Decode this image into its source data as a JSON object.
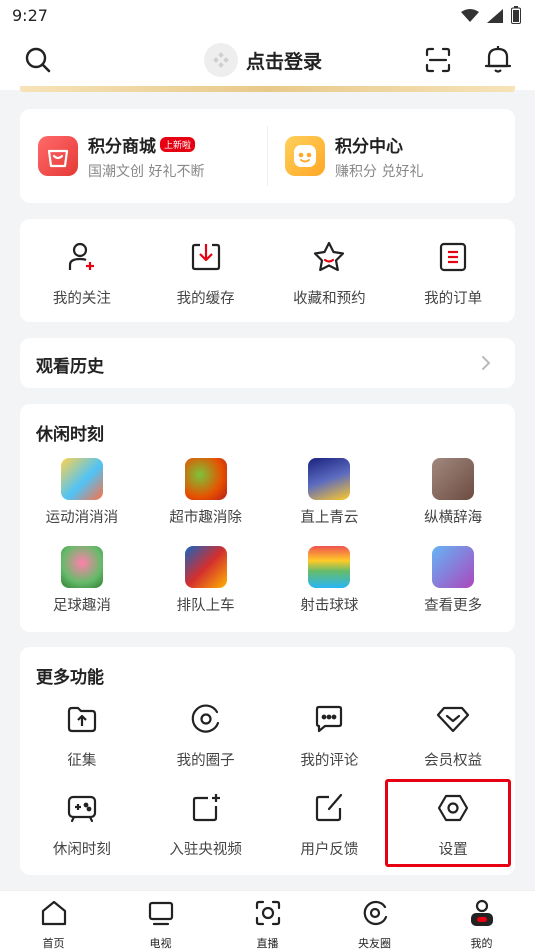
{
  "status_bar": {
    "time": "9:27",
    "icons": [
      "wifi-icon",
      "signal-icon",
      "battery-icon"
    ]
  },
  "header": {
    "login_label": "点击登录",
    "icons": [
      "search-icon",
      "scan-icon",
      "bell-icon"
    ]
  },
  "points": [
    {
      "title": "积分商城",
      "badge": "上新啦",
      "subtitle": "国潮文创 好礼不断",
      "icon": "shopping-bag-icon",
      "color": "#f24a4a"
    },
    {
      "title": "积分中心",
      "subtitle": "赚积分 兑好礼",
      "icon": "coin-face-icon",
      "color": "#ffb020"
    }
  ],
  "quick_actions": [
    {
      "label": "我的关注",
      "icon": "follow-user-icon"
    },
    {
      "label": "我的缓存",
      "icon": "download-icon"
    },
    {
      "label": "收藏和预约",
      "icon": "star-icon"
    },
    {
      "label": "我的订单",
      "icon": "order-icon"
    }
  ],
  "history": {
    "title": "观看历史"
  },
  "leisure": {
    "title": "休闲时刻",
    "games": [
      {
        "label": "运动消消消"
      },
      {
        "label": "超市趣消除"
      },
      {
        "label": "直上青云"
      },
      {
        "label": "纵横辞海"
      },
      {
        "label": "足球趣消"
      },
      {
        "label": "排队上车"
      },
      {
        "label": "射击球球"
      },
      {
        "label": "查看更多"
      }
    ]
  },
  "more_features": {
    "title": "更多功能",
    "items": [
      {
        "label": "征集",
        "icon": "upload-folder-icon"
      },
      {
        "label": "我的圈子",
        "icon": "circle-icon"
      },
      {
        "label": "我的评论",
        "icon": "comment-icon"
      },
      {
        "label": "会员权益",
        "icon": "diamond-icon"
      },
      {
        "label": "休闲时刻",
        "icon": "gamepad-icon"
      },
      {
        "label": "入驻央视频",
        "icon": "add-square-icon"
      },
      {
        "label": "用户反馈",
        "icon": "feedback-icon"
      },
      {
        "label": "设置",
        "icon": "settings-icon"
      }
    ]
  },
  "tabbar": [
    {
      "label": "首页",
      "icon": "home-icon"
    },
    {
      "label": "电视",
      "icon": "tv-icon"
    },
    {
      "label": "直播",
      "icon": "live-icon"
    },
    {
      "label": "央友圈",
      "icon": "circle-tab-icon"
    },
    {
      "label": "我的",
      "icon": "profile-icon"
    }
  ]
}
